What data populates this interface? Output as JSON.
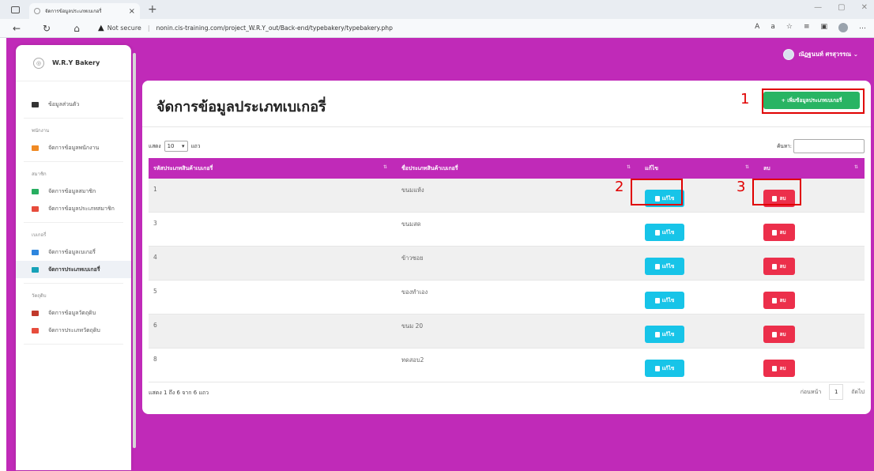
{
  "browser": {
    "tab_title": "จัดการข้อมูลประเภทเบเกอรี่",
    "tab_close": "×",
    "new_tab": "+",
    "security": "Not secure",
    "url": "nonin.cis-training.com/project_W.R.Y_out/Back-end/typebakery/typebakery.php"
  },
  "sidebar": {
    "brand": "W.R.Y Bakery",
    "items": [
      {
        "label": "ข้อมูลส่วนตัว",
        "color": "#333333"
      },
      {
        "heading": "พนักงาน"
      },
      {
        "label": "จัดการข้อมูลพนักงาน",
        "color": "#f08a24"
      },
      {
        "heading": "สมาชิก"
      },
      {
        "label": "จัดการข้อมูลสมาชิก",
        "color": "#27ae60"
      },
      {
        "label": "จัดการข้อมูลประเภทสมาชิก",
        "color": "#e74c3c"
      },
      {
        "heading": "เบเกอรี่"
      },
      {
        "label": "จัดการข้อมูลเบเกอรี่",
        "color": "#2e86de"
      },
      {
        "label": "จัดการประเภทเบเกอรี่",
        "color": "#17a2b8"
      },
      {
        "heading": "วัตถุดิบ"
      },
      {
        "label": "จัดการข้อมูลวัตถุดิบ",
        "color": "#c0392b"
      },
      {
        "label": "จัดการประเภทวัตถุดิบ",
        "color": "#e74c3c"
      }
    ]
  },
  "user": {
    "name": "ณัฏฐนนท์ ศรสุวรรณ ⌄"
  },
  "main": {
    "title": "จัดการข้อมูลประเภทเบเกอรี่",
    "add_button": "+ เพิ่มข้อมูลประเภทเบเกอรี่",
    "length_prefix": "แสดง",
    "length_value": "10",
    "length_suffix": "แถว",
    "search_label": "ค้นหา:",
    "search_value": "",
    "columns": [
      "รหัสประเภทสินค้าเบเกอรี่",
      "ชื่อประเภทสินค้าเบเกอรี่",
      "แก้ไข",
      "ลบ"
    ],
    "rows": [
      {
        "id": "1",
        "name": "ขนมแห้ง"
      },
      {
        "id": "3",
        "name": "ขนมสด"
      },
      {
        "id": "4",
        "name": "ข้าวซอย"
      },
      {
        "id": "5",
        "name": "ของทำเอง"
      },
      {
        "id": "6",
        "name": "ขนม 20"
      },
      {
        "id": "8",
        "name": "ทดสอบ2"
      }
    ],
    "edit_label": "แก้ไข",
    "delete_label": "ลบ",
    "info": "แสดง 1 ถึง 6 จาก 6 แถว",
    "pager": {
      "prev": "ก่อนหน้า",
      "page": "1",
      "next": "ถัดไป"
    }
  },
  "annotations": [
    "1",
    "2",
    "3"
  ],
  "colors": {
    "header_bg": "#c02ab8",
    "add_button": "#28b463",
    "edit_button": "#17c4e8",
    "delete_button": "#ec2f4b",
    "annotation": "#e00000"
  }
}
